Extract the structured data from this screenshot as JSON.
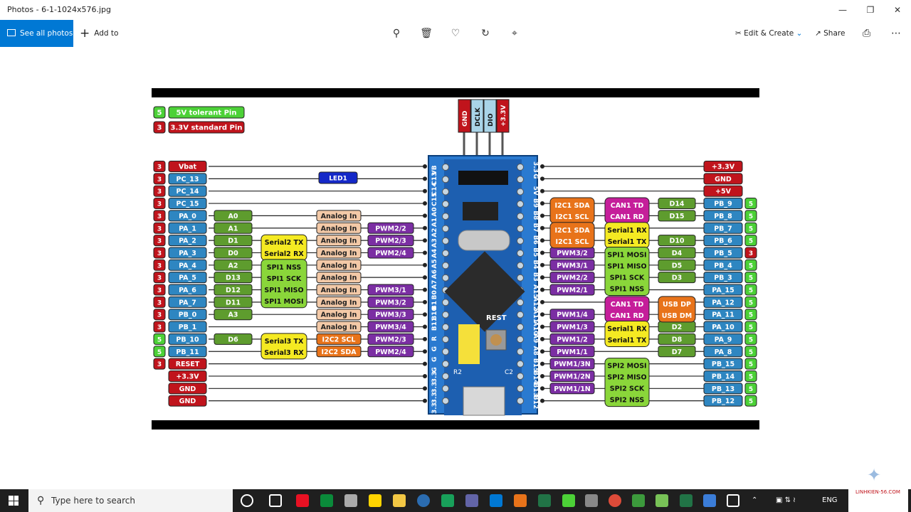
{
  "window": {
    "title": "Photos - 6-1-1024x576.jpg",
    "minimize": "—",
    "restore": "❐",
    "close": "✕"
  },
  "toolbar": {
    "see_all": "See all photos",
    "add_to": "Add to",
    "edit_create": "Edit & Create",
    "share": "Share",
    "more": "⋯"
  },
  "legend": [
    {
      "badge": "5",
      "label": "5V tolerant Pin",
      "color": "#4cd137"
    },
    {
      "badge": "3",
      "label": "3.3V standard Pin",
      "color": "#c0141c"
    }
  ],
  "top_header": [
    "GND",
    "DCLK",
    "DIO",
    "+3.3V"
  ],
  "board": {
    "led": "LED1",
    "rest": "REST",
    "r2": "R2",
    "c2": "C2"
  },
  "left_pins": [
    {
      "v": "3",
      "pin": "Vbat",
      "c": "#c0141c"
    },
    {
      "v": "3",
      "pin": "PC_13",
      "c": "#2e86c1"
    },
    {
      "v": "3",
      "pin": "PC_14",
      "c": "#2e86c1"
    },
    {
      "v": "3",
      "pin": "PC_15",
      "c": "#2e86c1"
    },
    {
      "v": "3",
      "pin": "PA_0",
      "c": "#2e86c1"
    },
    {
      "v": "3",
      "pin": "PA_1",
      "c": "#2e86c1"
    },
    {
      "v": "3",
      "pin": "PA_2",
      "c": "#2e86c1"
    },
    {
      "v": "3",
      "pin": "PA_3",
      "c": "#2e86c1"
    },
    {
      "v": "3",
      "pin": "PA_4",
      "c": "#2e86c1"
    },
    {
      "v": "3",
      "pin": "PA_5",
      "c": "#2e86c1"
    },
    {
      "v": "3",
      "pin": "PA_6",
      "c": "#2e86c1"
    },
    {
      "v": "3",
      "pin": "PA_7",
      "c": "#2e86c1"
    },
    {
      "v": "3",
      "pin": "PB_0",
      "c": "#2e86c1"
    },
    {
      "v": "3",
      "pin": "PB_1",
      "c": "#2e86c1"
    },
    {
      "v": "5",
      "pin": "PB_10",
      "c": "#2e86c1"
    },
    {
      "v": "5",
      "pin": "PB_11",
      "c": "#2e86c1"
    },
    {
      "v": "3",
      "pin": "RESET",
      "c": "#c0141c"
    },
    {
      "v": "",
      "pin": "+3.3V",
      "c": "#c0141c"
    },
    {
      "v": "",
      "pin": "GND",
      "c": "#c0141c"
    },
    {
      "v": "",
      "pin": "GND",
      "c": "#c0141c"
    }
  ],
  "left_arduino": [
    "",
    "",
    "",
    "",
    "A0",
    "A1",
    "D1",
    "D0",
    "A2",
    "D13",
    "D12",
    "D11",
    "A3",
    "",
    "D6",
    "",
    "",
    "",
    "",
    ""
  ],
  "left_analog": [
    "",
    "",
    "",
    "",
    "Analog In",
    "Analog In",
    "Analog In",
    "Analog In",
    "Analog In",
    "Analog In",
    "Analog In",
    "Analog In",
    "Analog In",
    "Analog In",
    "I2C2 SCL",
    "I2C2 SDA",
    "",
    "",
    "",
    ""
  ],
  "left_pwm": [
    "",
    "",
    "",
    "",
    "",
    "PWM2/2",
    "PWM2/3",
    "PWM2/4",
    "",
    "",
    "PWM3/1",
    "PWM3/2",
    "PWM3/3",
    "PWM3/4",
    "PWM2/3",
    "PWM2/4",
    "",
    "",
    "",
    ""
  ],
  "left_serial2": [
    "Serial2 TX",
    "Serial2 RX"
  ],
  "left_spi1": [
    "SPI1 NSS",
    "SPI1 SCK",
    "SPI1 MISO",
    "SPI1 MOSI"
  ],
  "left_serial3": [
    "Serial3 TX",
    "Serial3 RX"
  ],
  "right_pins": [
    {
      "v": "",
      "pin": "+3.3V",
      "c": "#c0141c"
    },
    {
      "v": "",
      "pin": "GND",
      "c": "#c0141c"
    },
    {
      "v": "",
      "pin": "+5V",
      "c": "#c0141c"
    },
    {
      "v": "5",
      "pin": "PB_9",
      "c": "#2e86c1"
    },
    {
      "v": "5",
      "pin": "PB_8",
      "c": "#2e86c1"
    },
    {
      "v": "5",
      "pin": "PB_7",
      "c": "#2e86c1"
    },
    {
      "v": "5",
      "pin": "PB_6",
      "c": "#2e86c1"
    },
    {
      "v": "3",
      "pin": "PB_5",
      "c": "#2e86c1"
    },
    {
      "v": "5",
      "pin": "PB_4",
      "c": "#2e86c1"
    },
    {
      "v": "5",
      "pin": "PB_3",
      "c": "#2e86c1"
    },
    {
      "v": "5",
      "pin": "PA_15",
      "c": "#2e86c1"
    },
    {
      "v": "5",
      "pin": "PA_12",
      "c": "#2e86c1"
    },
    {
      "v": "5",
      "pin": "PA_11",
      "c": "#2e86c1"
    },
    {
      "v": "5",
      "pin": "PA_10",
      "c": "#2e86c1"
    },
    {
      "v": "5",
      "pin": "PA_9",
      "c": "#2e86c1"
    },
    {
      "v": "5",
      "pin": "PA_8",
      "c": "#2e86c1"
    },
    {
      "v": "5",
      "pin": "PB_15",
      "c": "#2e86c1"
    },
    {
      "v": "5",
      "pin": "PB_14",
      "c": "#2e86c1"
    },
    {
      "v": "5",
      "pin": "PB_13",
      "c": "#2e86c1"
    },
    {
      "v": "5",
      "pin": "PB_12",
      "c": "#2e86c1"
    }
  ],
  "right_arduino": [
    "",
    "",
    "",
    "D14",
    "D15",
    "",
    "D10",
    "D4",
    "D5",
    "D3",
    "",
    "",
    "",
    "D2",
    "D8",
    "D7",
    "",
    "",
    "",
    ""
  ],
  "right_i2c": [
    "",
    "",
    "",
    "I2C1 SDA",
    "I2C1 SCL",
    "I2C1 SDA",
    "I2C1 SCL",
    "",
    "",
    "",
    "",
    "",
    "",
    "",
    "",
    "",
    "",
    "",
    "",
    ""
  ],
  "right_pwm": [
    "",
    "",
    "",
    "",
    "",
    "",
    "",
    "PWM3/2",
    "PWM3/1",
    "PWM2/2",
    "PWM2/1",
    "",
    "PWM1/4",
    "PWM1/3",
    "PWM1/2",
    "PWM1/1",
    "PWM1/3N",
    "PWM1/2N",
    "PWM1/1N",
    ""
  ],
  "right_can": [
    "CAN1 TD",
    "CAN1 RD",
    "CAN1 TD",
    "CAN1 RD"
  ],
  "right_serial1": [
    "Serial1 RX",
    "Serial1 TX",
    "Serial1 RX",
    "Serial1 TX"
  ],
  "right_spi1": [
    "SPI1 MOSI",
    "SPI1 MISO",
    "SPI1 SCK",
    "SPI1 NSS"
  ],
  "right_usb": [
    "USB DP",
    "USB DM"
  ],
  "right_spi2": [
    "SPI2 MOSI",
    "SPI2 MISO",
    "SPI2 SCK",
    "SPI2 NSS"
  ],
  "board_left_labels": [
    "3.3",
    "3.3",
    "3.3",
    "3.3",
    "G",
    "G",
    "G",
    "R",
    "B11",
    "B10",
    "B1",
    "B0",
    "A7",
    "A6",
    "A5",
    "A4",
    "A3",
    "A2",
    "A1",
    "A0",
    "C15",
    "C14",
    "C13",
    "VB"
  ],
  "board_right_labels": [
    "3.3",
    "G",
    "5V",
    "B9",
    "B8",
    "B7",
    "B6",
    "B5",
    "B4",
    "B3",
    "A15",
    "A12",
    "A11",
    "A10",
    "A9",
    "A8",
    "B15",
    "B14",
    "B13",
    "B12"
  ],
  "taskbar": {
    "search_placeholder": "Type here to search",
    "lang": "ENG",
    "watermark": "LINHKIEN-56.COM"
  }
}
